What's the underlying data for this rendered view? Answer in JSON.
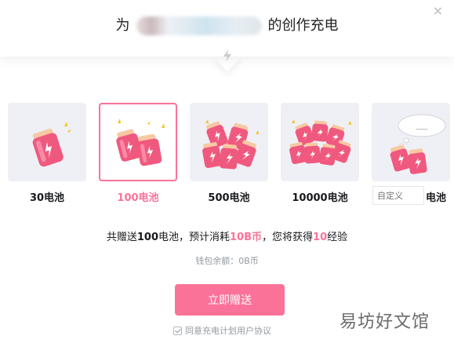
{
  "dialog": {
    "title_prefix": "为",
    "title_suffix": "的创作充电",
    "close": "×"
  },
  "options": [
    {
      "label": "30电池",
      "selected": false
    },
    {
      "label": "100电池",
      "selected": true
    },
    {
      "label": "500电池",
      "selected": false
    },
    {
      "label": "10000电池",
      "selected": false
    }
  ],
  "custom": {
    "placeholder": "自定义",
    "unit": "电池",
    "bubble": "___"
  },
  "summary": {
    "part1": "共赠送",
    "amount": "100",
    "part2": "电池，预计消耗",
    "cost": "10B币",
    "part3": "，您将获得",
    "exp": "10",
    "part4": "经验"
  },
  "wallet": "钱包余额：0B币",
  "submit_label": "立即赠送",
  "agreement": "同意充电计划用户协议",
  "watermark": "易坊好文馆",
  "colors": {
    "accent": "#fb7299",
    "battery_body": "#f0597f",
    "battery_cap": "#f7c9a3",
    "card_bg": "#eef0f5"
  }
}
